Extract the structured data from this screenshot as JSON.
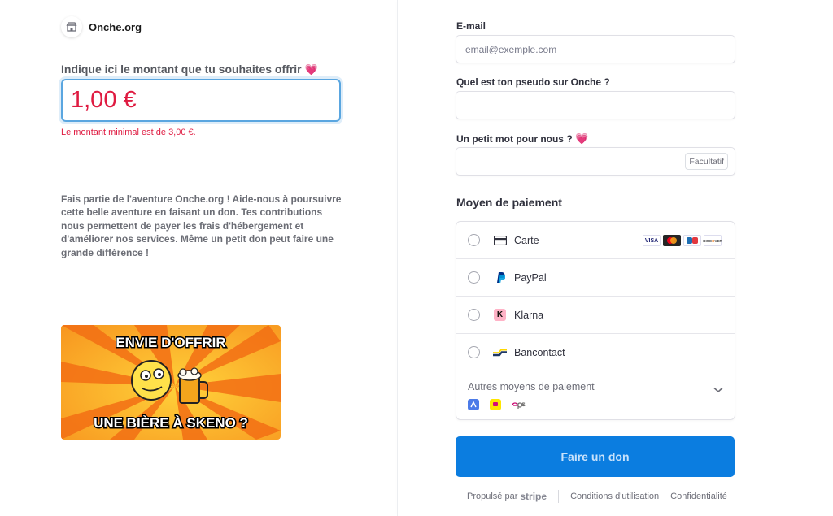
{
  "brand": {
    "name": "Onche.org",
    "icon": "shop-icon"
  },
  "amount": {
    "label": "Indique ici le montant que tu souhaites offrir",
    "value": "1,00 €",
    "error": "Le montant minimal est de 3,00 €."
  },
  "description": "Fais partie de l'aventure Onche.org ! Aide-nous à poursuivre cette belle aventure en faisant un don. Tes contributions nous permettent de payer les frais d'hébergement et d'améliorer nos services. Même un petit don peut faire une grande différence !",
  "banner": {
    "top_text": "ENVIE D'OFFRIR",
    "bottom_text": "UNE BIÈRE À SKENO ?"
  },
  "form": {
    "email_label": "E-mail",
    "email_placeholder": "email@exemple.com",
    "pseudo_label": "Quel est ton pseudo sur Onche ?",
    "message_label": "Un petit mot pour nous ?",
    "optional_tag": "Facultatif"
  },
  "payment": {
    "title": "Moyen de paiement",
    "methods": [
      {
        "label": "Carte",
        "icon": "credit-card-icon"
      },
      {
        "label": "PayPal",
        "icon": "paypal-icon"
      },
      {
        "label": "Klarna",
        "icon": "klarna-icon"
      },
      {
        "label": "Bancontact",
        "icon": "bancontact-icon"
      }
    ],
    "card_brands": [
      "VISA",
      "MC",
      "CB",
      "DISCOVER"
    ],
    "other_label": "Autres moyens de paiement"
  },
  "donate_button": "Faire un don",
  "footer": {
    "powered": "Propulsé par",
    "stripe": "stripe",
    "terms": "Conditions d'utilisation",
    "privacy": "Confidentialité"
  },
  "colors": {
    "accent": "#0b7de0",
    "error": "#df1b41",
    "heart": "#ee5c8d"
  }
}
